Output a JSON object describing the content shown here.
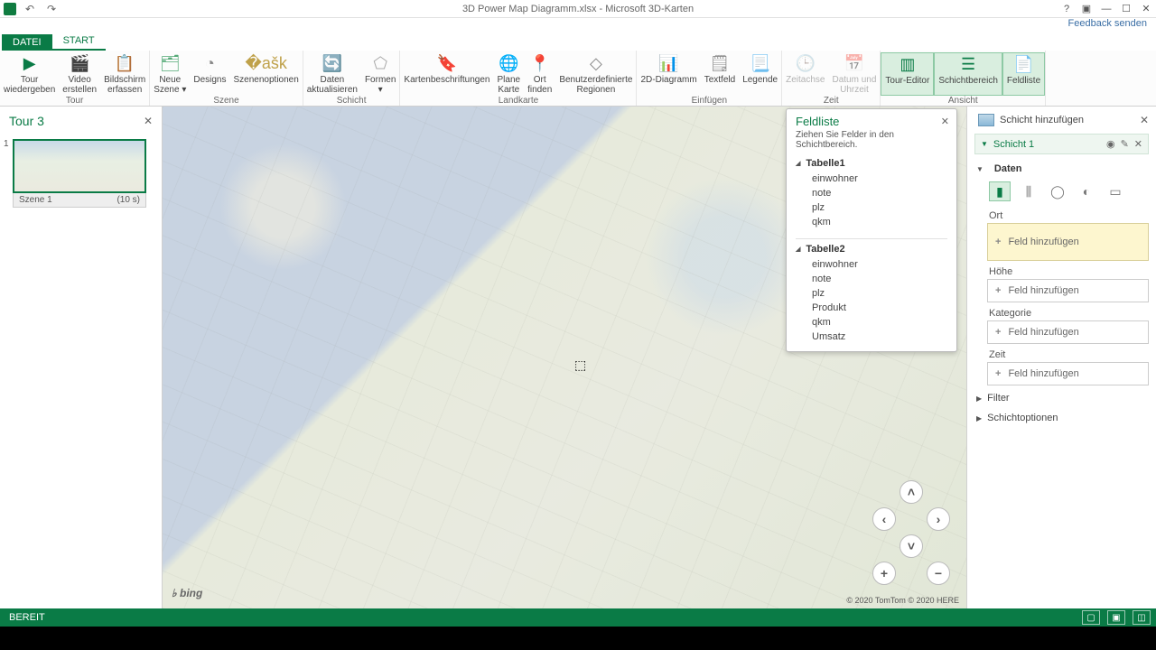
{
  "title": "3D Power Map Diagramm.xlsx - Microsoft 3D-Karten",
  "feedback": "Feedback senden",
  "tabs": {
    "file": "DATEI",
    "start": "START"
  },
  "ribbon": {
    "groups": [
      {
        "label": "Tour",
        "items": [
          {
            "key": "play",
            "label": "Tour\nwiedergeben",
            "icon": "▶",
            "color": "#0a7b46"
          },
          {
            "key": "video",
            "label": "Video\nerstellen",
            "icon": "🎬",
            "color": "#555"
          },
          {
            "key": "screenshot",
            "label": "Bildschirm\nerfassen",
            "icon": "📋",
            "color": "#a85"
          }
        ]
      },
      {
        "label": "Szene",
        "items": [
          {
            "key": "newscene",
            "label": "Neue\nSzene ▾",
            "icon": "🗂",
            "color": "#5a7"
          },
          {
            "key": "designs",
            "label": "Designs",
            "icon": "◔",
            "color": "#888"
          },
          {
            "key": "sceneopt",
            "label": "Szenenoptionen",
            "icon": "�ašk",
            "color": "#bfa14a"
          }
        ]
      },
      {
        "label": "Schicht",
        "items": [
          {
            "key": "refresh",
            "label": "Daten\naktualisieren",
            "icon": "🔄",
            "color": "#3a78b5"
          },
          {
            "key": "shapes",
            "label": "Formen\n▾",
            "icon": "⬠",
            "color": "#aaa"
          }
        ]
      },
      {
        "label": "Landkarte",
        "items": [
          {
            "key": "maplabels",
            "label": "Kartenbeschriftungen",
            "icon": "🔖",
            "color": "#c77"
          },
          {
            "key": "flatmap",
            "label": "Plane\nKarte",
            "icon": "🌐",
            "color": "#5a8bc9"
          },
          {
            "key": "findloc",
            "label": "Ort\nfinden",
            "icon": "📍",
            "color": "#c96"
          },
          {
            "key": "custreg",
            "label": "Benutzerdefinierte\nRegionen",
            "icon": "◇",
            "color": "#888"
          }
        ]
      },
      {
        "label": "Einfügen",
        "items": [
          {
            "key": "chart2d",
            "label": "2D-Diagramm",
            "icon": "📊",
            "color": "#d08030"
          },
          {
            "key": "textbox",
            "label": "Textfeld",
            "icon": "🗒",
            "color": "#888"
          },
          {
            "key": "legend",
            "label": "Legende",
            "icon": "📃",
            "color": "#888"
          }
        ]
      },
      {
        "label": "Zeit",
        "items": [
          {
            "key": "timeline",
            "label": "Zeitachse",
            "icon": "🕒",
            "color": "#bbb",
            "disabled": true
          },
          {
            "key": "datetime",
            "label": "Datum und\nUhrzeit",
            "icon": "📅",
            "color": "#bbb",
            "disabled": true
          }
        ]
      },
      {
        "label": "Ansicht",
        "items": [
          {
            "key": "toureditor",
            "label": "Tour-Editor",
            "icon": "▥",
            "color": "#0a7b46",
            "active": true
          },
          {
            "key": "layerpane",
            "label": "Schichtbereich",
            "icon": "☰",
            "color": "#0a7b46",
            "active": true
          },
          {
            "key": "fieldlist",
            "label": "Feldliste",
            "icon": "📄",
            "color": "#0a7b46",
            "active": true
          }
        ]
      }
    ]
  },
  "tour": {
    "title": "Tour 3",
    "scene": {
      "index": "1",
      "name": "Szene 1",
      "duration": "(10 s)"
    }
  },
  "fieldlist": {
    "title": "Feldliste",
    "hint": "Ziehen Sie Felder in den Schichtbereich.",
    "tables": [
      {
        "name": "Tabelle1",
        "fields": [
          "einwohner",
          "note",
          "plz",
          "qkm"
        ]
      },
      {
        "name": "Tabelle2",
        "fields": [
          "einwohner",
          "note",
          "plz",
          "Produkt",
          "qkm",
          "Umsatz"
        ]
      }
    ]
  },
  "layer": {
    "add": "Schicht hinzufügen",
    "name": "Schicht 1",
    "data": "Daten",
    "ort": "Ort",
    "hoehe": "Höhe",
    "kategorie": "Kategorie",
    "zeit": "Zeit",
    "filter": "Filter",
    "optionen": "Schichtoptionen",
    "addfield": "Feld hinzufügen"
  },
  "map": {
    "bing": "bing",
    "credits": "© 2020 TomTom © 2020 HERE"
  },
  "status": {
    "ready": "BEREIT"
  }
}
